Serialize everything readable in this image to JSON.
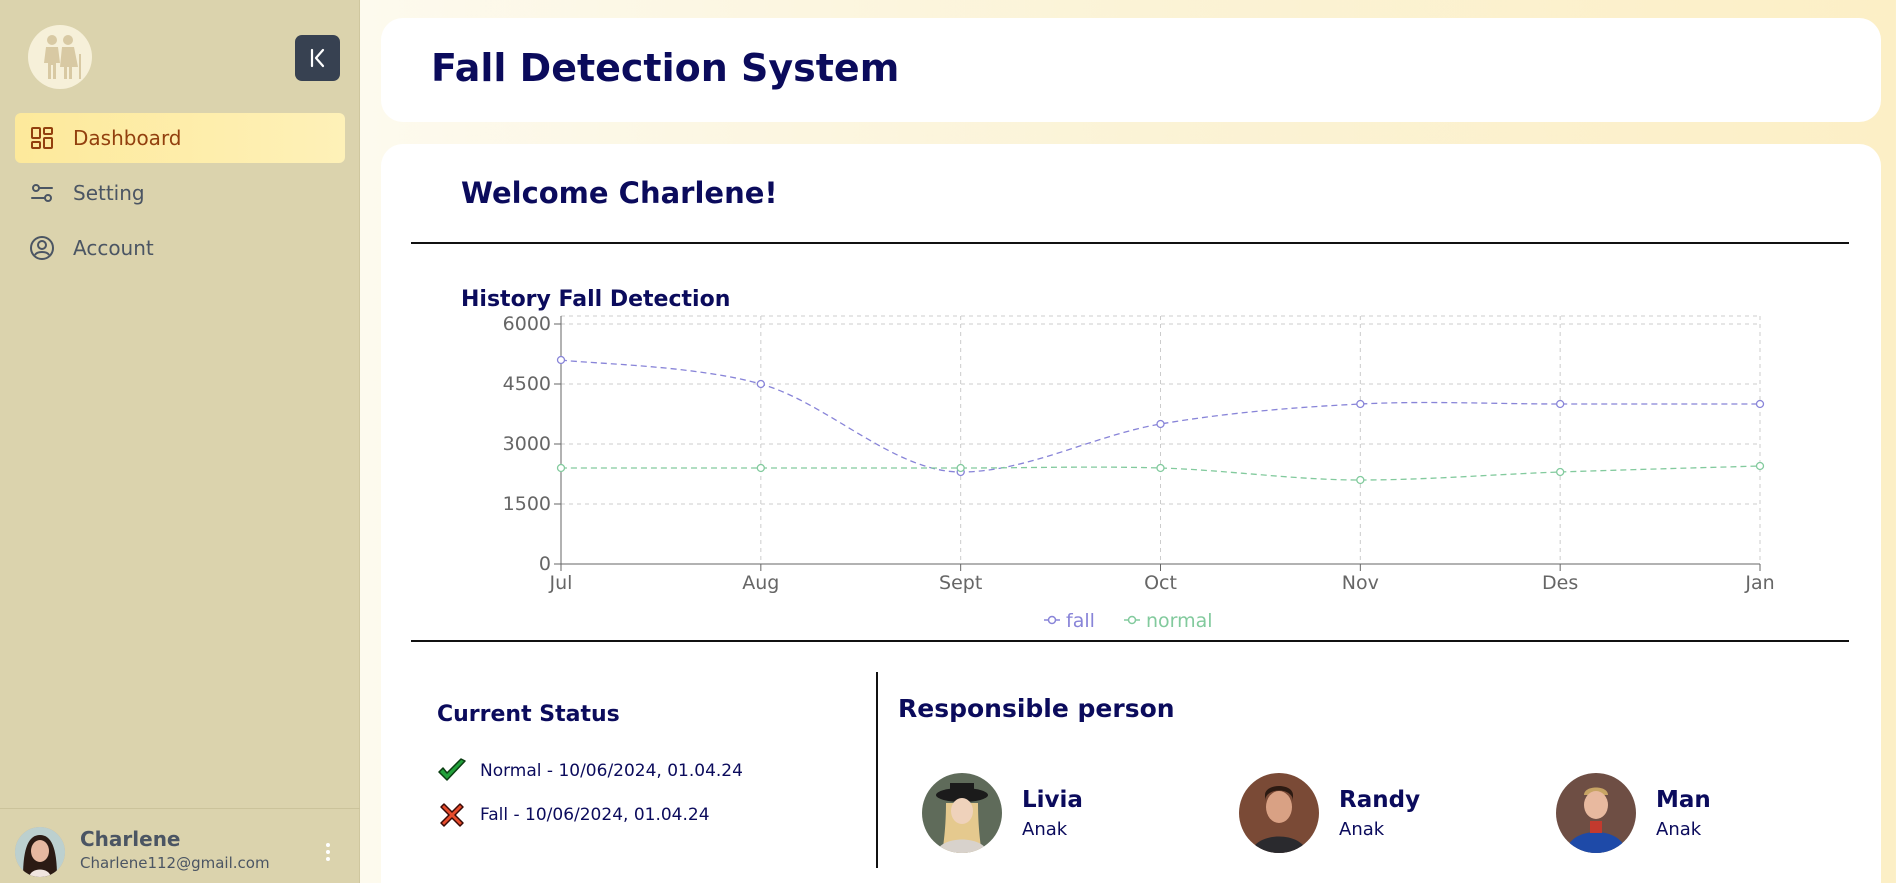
{
  "app": {
    "title": "Fall Detection System"
  },
  "sidebar": {
    "items": [
      {
        "label": "Dashboard",
        "icon": "dashboard-grid-icon",
        "active": true
      },
      {
        "label": "Setting",
        "icon": "sliders-icon",
        "active": false
      },
      {
        "label": "Account",
        "icon": "user-circle-icon",
        "active": false
      }
    ],
    "user": {
      "name": "Charlene",
      "email": "Charlene112@gmail.com"
    }
  },
  "main": {
    "welcome": "Welcome Charlene!",
    "chart_title": "History Fall Detection",
    "status": {
      "title": "Current Status",
      "items": [
        {
          "text": "Normal - 10/06/2024, 01.04.24",
          "icon": "check-icon"
        },
        {
          "text": "Fall - 10/06/2024, 01.04.24",
          "icon": "cross-icon"
        }
      ]
    },
    "responsible": {
      "title": "Responsible person",
      "people": [
        {
          "name": "Livia",
          "role": "Anak"
        },
        {
          "name": "Randy",
          "role": "Anak"
        },
        {
          "name": "Man",
          "role": "Anak"
        }
      ]
    }
  },
  "colors": {
    "fall": "#8884d8",
    "normal": "#82ca9d",
    "accent": "#0b0b5c"
  },
  "chart_data": {
    "type": "line",
    "categories": [
      "Jul",
      "Aug",
      "Sept",
      "Oct",
      "Nov",
      "Des",
      "Jan"
    ],
    "series": [
      {
        "name": "fall",
        "values": [
          5100,
          4500,
          2300,
          3500,
          4000,
          4000,
          4000
        ]
      },
      {
        "name": "normal",
        "values": [
          2400,
          2400,
          2400,
          2400,
          2100,
          2300,
          2450
        ]
      }
    ],
    "yticks": [
      0,
      1500,
      3000,
      4500,
      6000
    ],
    "ylim": [
      0,
      6000
    ],
    "grid": true,
    "line_style": "dashed",
    "legend_position": "bottom"
  }
}
